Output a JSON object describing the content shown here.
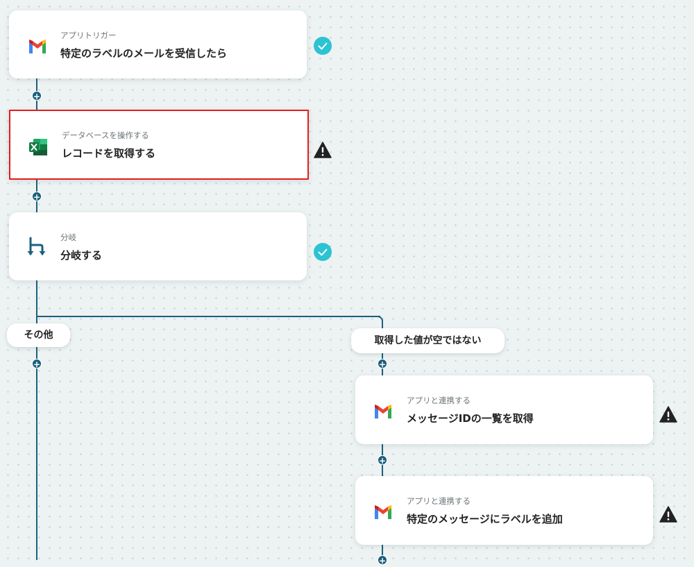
{
  "steps": [
    {
      "category": "アプリトリガー",
      "title": "特定のラベルのメールを受信したら",
      "icon": "gmail-icon",
      "status": "completed"
    },
    {
      "category": "データベースを操作する",
      "title": "レコードを取得する",
      "icon": "excel-icon",
      "status": "warning"
    },
    {
      "category": "分岐",
      "title": "分岐する",
      "icon": "branch-icon",
      "status": "completed"
    },
    {
      "category": "アプリと連携する",
      "title": "メッセージIDの一覧を取得",
      "icon": "gmail-icon",
      "status": "warning"
    },
    {
      "category": "アプリと連携する",
      "title": "特定のメッセージにラベルを追加",
      "icon": "gmail-icon",
      "status": "warning"
    }
  ],
  "branches": {
    "other_label": "その他",
    "condition_label": "取得した値が空ではない"
  },
  "add_symbol": "+",
  "colors": {
    "connector": "#1b5f7c",
    "completed": "#2cc3d2",
    "warning": "#222222",
    "selected_border": "#e01e1e"
  }
}
